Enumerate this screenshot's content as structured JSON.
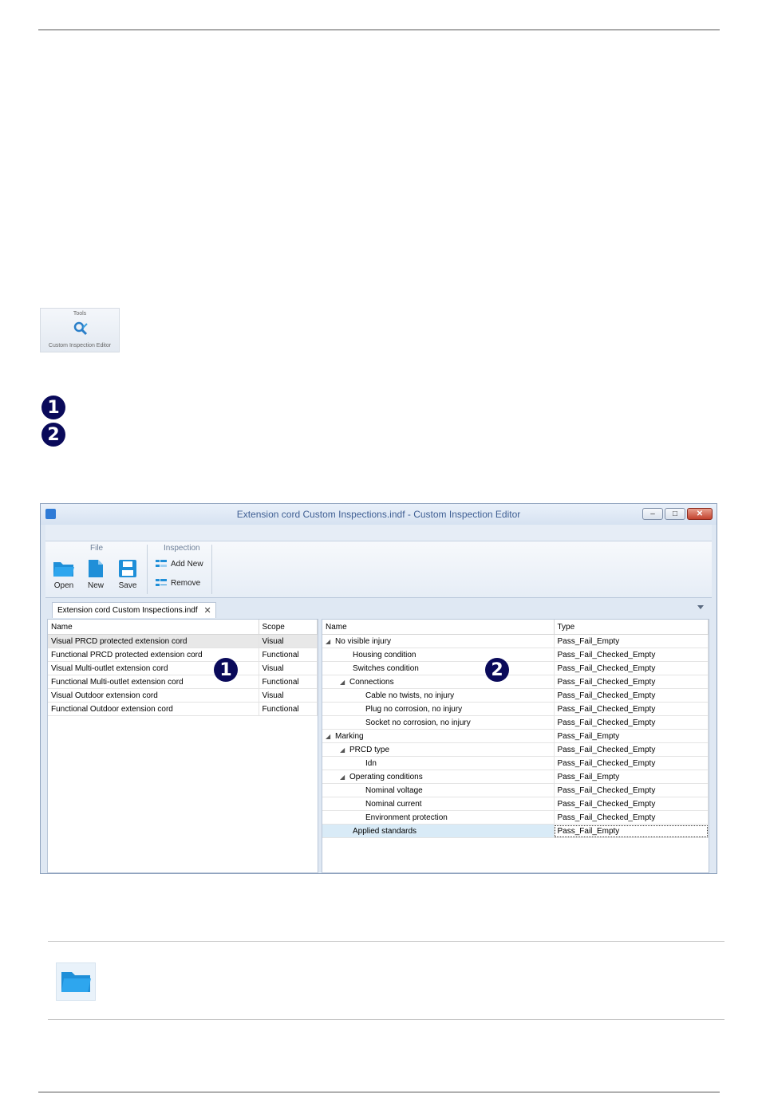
{
  "tools_snippet": {
    "group_label": "Tools",
    "button_label": "Custom Inspection Editor"
  },
  "markers": {
    "one": "1",
    "two": "2"
  },
  "window": {
    "title": "Extension cord Custom Inspections.indf - Custom Inspection Editor",
    "buttons": {
      "minimize": "–",
      "maximize": "□",
      "close": "✕"
    },
    "ribbon": {
      "file_group": "File",
      "inspection_group": "Inspection",
      "open": "Open",
      "new": "New",
      "save": "Save",
      "add_new": "Add New",
      "remove": "Remove"
    },
    "tab": {
      "label": "Extension cord Custom Inspections.indf",
      "close": "✕"
    },
    "left_grid": {
      "columns": [
        "Name",
        "Scope"
      ],
      "rows": [
        {
          "name": "Visual PRCD protected extension cord",
          "scope": "Visual"
        },
        {
          "name": "Functional PRCD protected extension cord",
          "scope": "Functional"
        },
        {
          "name": "Visual Multi-outlet extension cord",
          "scope": "Visual"
        },
        {
          "name": "Functional Multi-outlet extension cord",
          "scope": "Functional"
        },
        {
          "name": "Visual Outdoor extension cord",
          "scope": "Visual"
        },
        {
          "name": "Functional Outdoor extension cord",
          "scope": "Functional"
        }
      ]
    },
    "right_grid": {
      "columns": [
        "Name",
        "Type"
      ],
      "rows": [
        {
          "name": "No visible injury",
          "type": "Pass_Fail_Empty"
        },
        {
          "name": "Housing condition",
          "type": "Pass_Fail_Checked_Empty"
        },
        {
          "name": "Switches condition",
          "type": "Pass_Fail_Checked_Empty"
        },
        {
          "name": "Connections",
          "type": "Pass_Fail_Checked_Empty"
        },
        {
          "name": "Cable no twists, no injury",
          "type": "Pass_Fail_Checked_Empty"
        },
        {
          "name": "Plug no corrosion, no injury",
          "type": "Pass_Fail_Checked_Empty"
        },
        {
          "name": "Socket no corrosion, no injury",
          "type": "Pass_Fail_Checked_Empty"
        },
        {
          "name": "Marking",
          "type": "Pass_Fail_Empty"
        },
        {
          "name": "PRCD type",
          "type": "Pass_Fail_Checked_Empty"
        },
        {
          "name": "Idn",
          "type": "Pass_Fail_Checked_Empty"
        },
        {
          "name": "Operating conditions",
          "type": "Pass_Fail_Empty"
        },
        {
          "name": "Nominal voltage",
          "type": "Pass_Fail_Checked_Empty"
        },
        {
          "name": "Nominal current",
          "type": "Pass_Fail_Checked_Empty"
        },
        {
          "name": "Environment protection",
          "type": "Pass_Fail_Checked_Empty"
        },
        {
          "name": "Applied standards",
          "type": "Pass_Fail_Empty"
        }
      ]
    }
  },
  "colors": {
    "accent": "#2a9fe0",
    "marker": "#0a0a5a"
  }
}
